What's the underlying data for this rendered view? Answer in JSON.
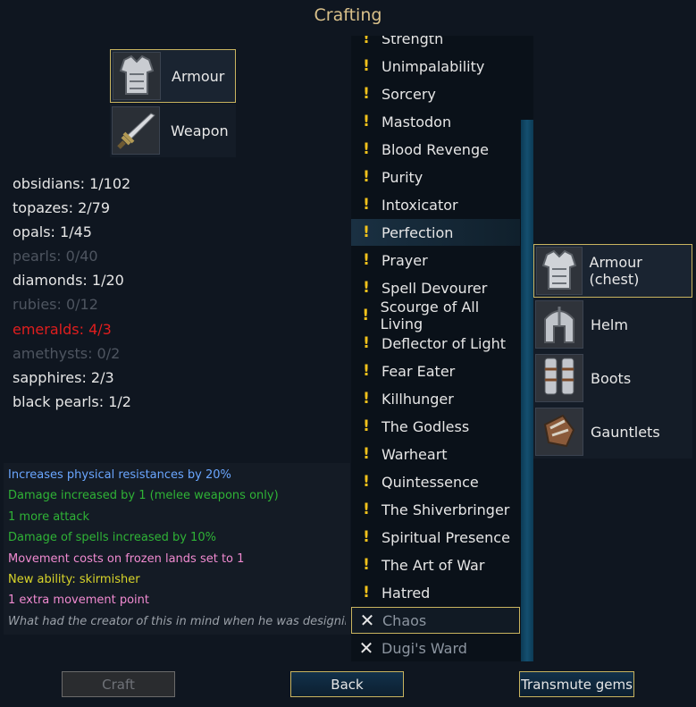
{
  "title": "Crafting",
  "item_types": [
    {
      "label": "Armour",
      "icon": "armour-icon",
      "selected": true
    },
    {
      "label": "Weapon",
      "icon": "sword-icon",
      "selected": false
    }
  ],
  "gems": [
    {
      "text": "obsidians: 1/102",
      "state": "ok"
    },
    {
      "text": "topazes: 2/79",
      "state": "ok"
    },
    {
      "text": "opals: 1/45",
      "state": "ok"
    },
    {
      "text": "pearls: 0/40",
      "state": "dim"
    },
    {
      "text": "diamonds: 1/20",
      "state": "ok"
    },
    {
      "text": "rubies: 0/12",
      "state": "dim"
    },
    {
      "text": "emeralds: 4/3",
      "state": "over"
    },
    {
      "text": "amethysts: 0/2",
      "state": "dim"
    },
    {
      "text": "sapphires: 2/3",
      "state": "ok"
    },
    {
      "text": "black pearls: 1/2",
      "state": "ok"
    }
  ],
  "effects": [
    {
      "text": "Increases physical resistances by 20%",
      "color": "#6aa6ff"
    },
    {
      "text": "Damage increased by 1 (melee weapons only)",
      "color": "#2fb336"
    },
    {
      "text": "1 more attack",
      "color": "#2fb336"
    },
    {
      "text": "Damage of spells increased by 10%",
      "color": "#2fb336"
    },
    {
      "text": "Movement costs on frozen lands set to 1",
      "color": "#f08ad0"
    },
    {
      "text": "New ability: skirmisher",
      "color": "#d8d42a"
    },
    {
      "text": "1 extra movement point",
      "color": "#f08ad0"
    },
    {
      "text": "What had the creator of this in mind when he was designing?",
      "color": "#9aa0a8",
      "italic": true
    }
  ],
  "recipes": [
    {
      "label": "Strength",
      "status": "available"
    },
    {
      "label": "Unimpalability",
      "status": "available"
    },
    {
      "label": "Sorcery",
      "status": "available"
    },
    {
      "label": "Mastodon",
      "status": "available"
    },
    {
      "label": "Blood Revenge",
      "status": "available"
    },
    {
      "label": "Purity",
      "status": "available"
    },
    {
      "label": "Intoxicator",
      "status": "available"
    },
    {
      "label": "Perfection",
      "status": "available",
      "highlight": true
    },
    {
      "label": "Prayer",
      "status": "available"
    },
    {
      "label": "Spell Devourer",
      "status": "available"
    },
    {
      "label": "Scourge of All Living",
      "status": "available"
    },
    {
      "label": "Deflector of Light",
      "status": "available"
    },
    {
      "label": "Fear Eater",
      "status": "available"
    },
    {
      "label": "Killhunger",
      "status": "available"
    },
    {
      "label": "The Godless",
      "status": "available"
    },
    {
      "label": "Warheart",
      "status": "available"
    },
    {
      "label": "Quintessence",
      "status": "available"
    },
    {
      "label": "The Shiverbringer",
      "status": "available"
    },
    {
      "label": "Spiritual Presence",
      "status": "available"
    },
    {
      "label": "The Art of War",
      "status": "available"
    },
    {
      "label": "Hatred",
      "status": "available"
    },
    {
      "label": "Chaos",
      "status": "unavailable",
      "selected": true
    },
    {
      "label": "Dugi's Ward",
      "status": "unavailable"
    }
  ],
  "icons": {
    "available": "!",
    "unavailable": "✕"
  },
  "slots": [
    {
      "label": "Armour (chest)",
      "icon": "chest-armour-icon",
      "selected": true
    },
    {
      "label": "Helm",
      "icon": "helm-icon",
      "selected": false
    },
    {
      "label": "Boots",
      "icon": "boots-icon",
      "selected": false
    },
    {
      "label": "Gauntlets",
      "icon": "gauntlets-icon",
      "selected": false
    }
  ],
  "buttons": {
    "craft": "Craft",
    "back": "Back",
    "transmute": "Transmute gems"
  }
}
